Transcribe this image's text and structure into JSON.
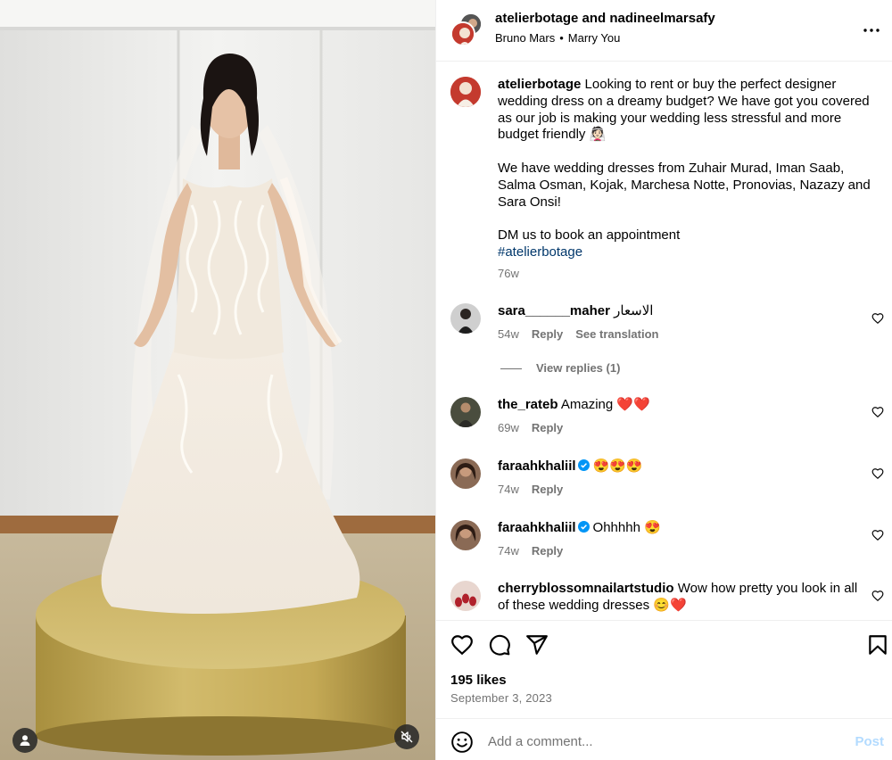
{
  "header": {
    "title": "atelierbotage and nadineelmarsafy",
    "music_artist": "Bruno Mars",
    "music_separator": "•",
    "music_track": "Marry You"
  },
  "caption": {
    "username": "atelierbotage",
    "para1": "Looking to rent or buy the perfect designer wedding dress on a dreamy budget? We have got you covered as our job is making your wedding less stressful and more budget friendly 👰🏻",
    "para2": "We have wedding dresses from Zuhair Murad, Iman Saab, Salma Osman, Kojak, Marchesa Notte, Pronovias, Nazazy and Sara Onsi!",
    "para3": "DM us to book an appointment",
    "hashtag": "#atelierbotage",
    "time": "76w"
  },
  "comments": [
    {
      "username": "sara______maher",
      "text": "الاسعار",
      "time": "54w",
      "reply": "Reply",
      "translate": "See translation",
      "view_replies": "View replies (1)"
    },
    {
      "username": "the_rateb",
      "text": "Amazing ❤️❤️",
      "time": "69w",
      "reply": "Reply"
    },
    {
      "username": "faraahkhaliil",
      "text": "😍😍😍",
      "time": "74w",
      "reply": "Reply",
      "verified": true
    },
    {
      "username": "faraahkhaliil",
      "text": "Ohhhhh 😍",
      "time": "74w",
      "reply": "Reply",
      "verified": true
    },
    {
      "username": "cherryblossomnailartstudio",
      "text": "Wow how pretty you look in all of these wedding dresses 😊❤️"
    }
  ],
  "stats": {
    "likes": "195 likes",
    "date": "September 3, 2023"
  },
  "add_comment": {
    "placeholder": "Add a comment...",
    "post_label": "Post"
  },
  "colors": {
    "link": "#00376b",
    "verified": "#0095f6",
    "muted": "#737373",
    "post_disabled": "#b3dbff"
  }
}
